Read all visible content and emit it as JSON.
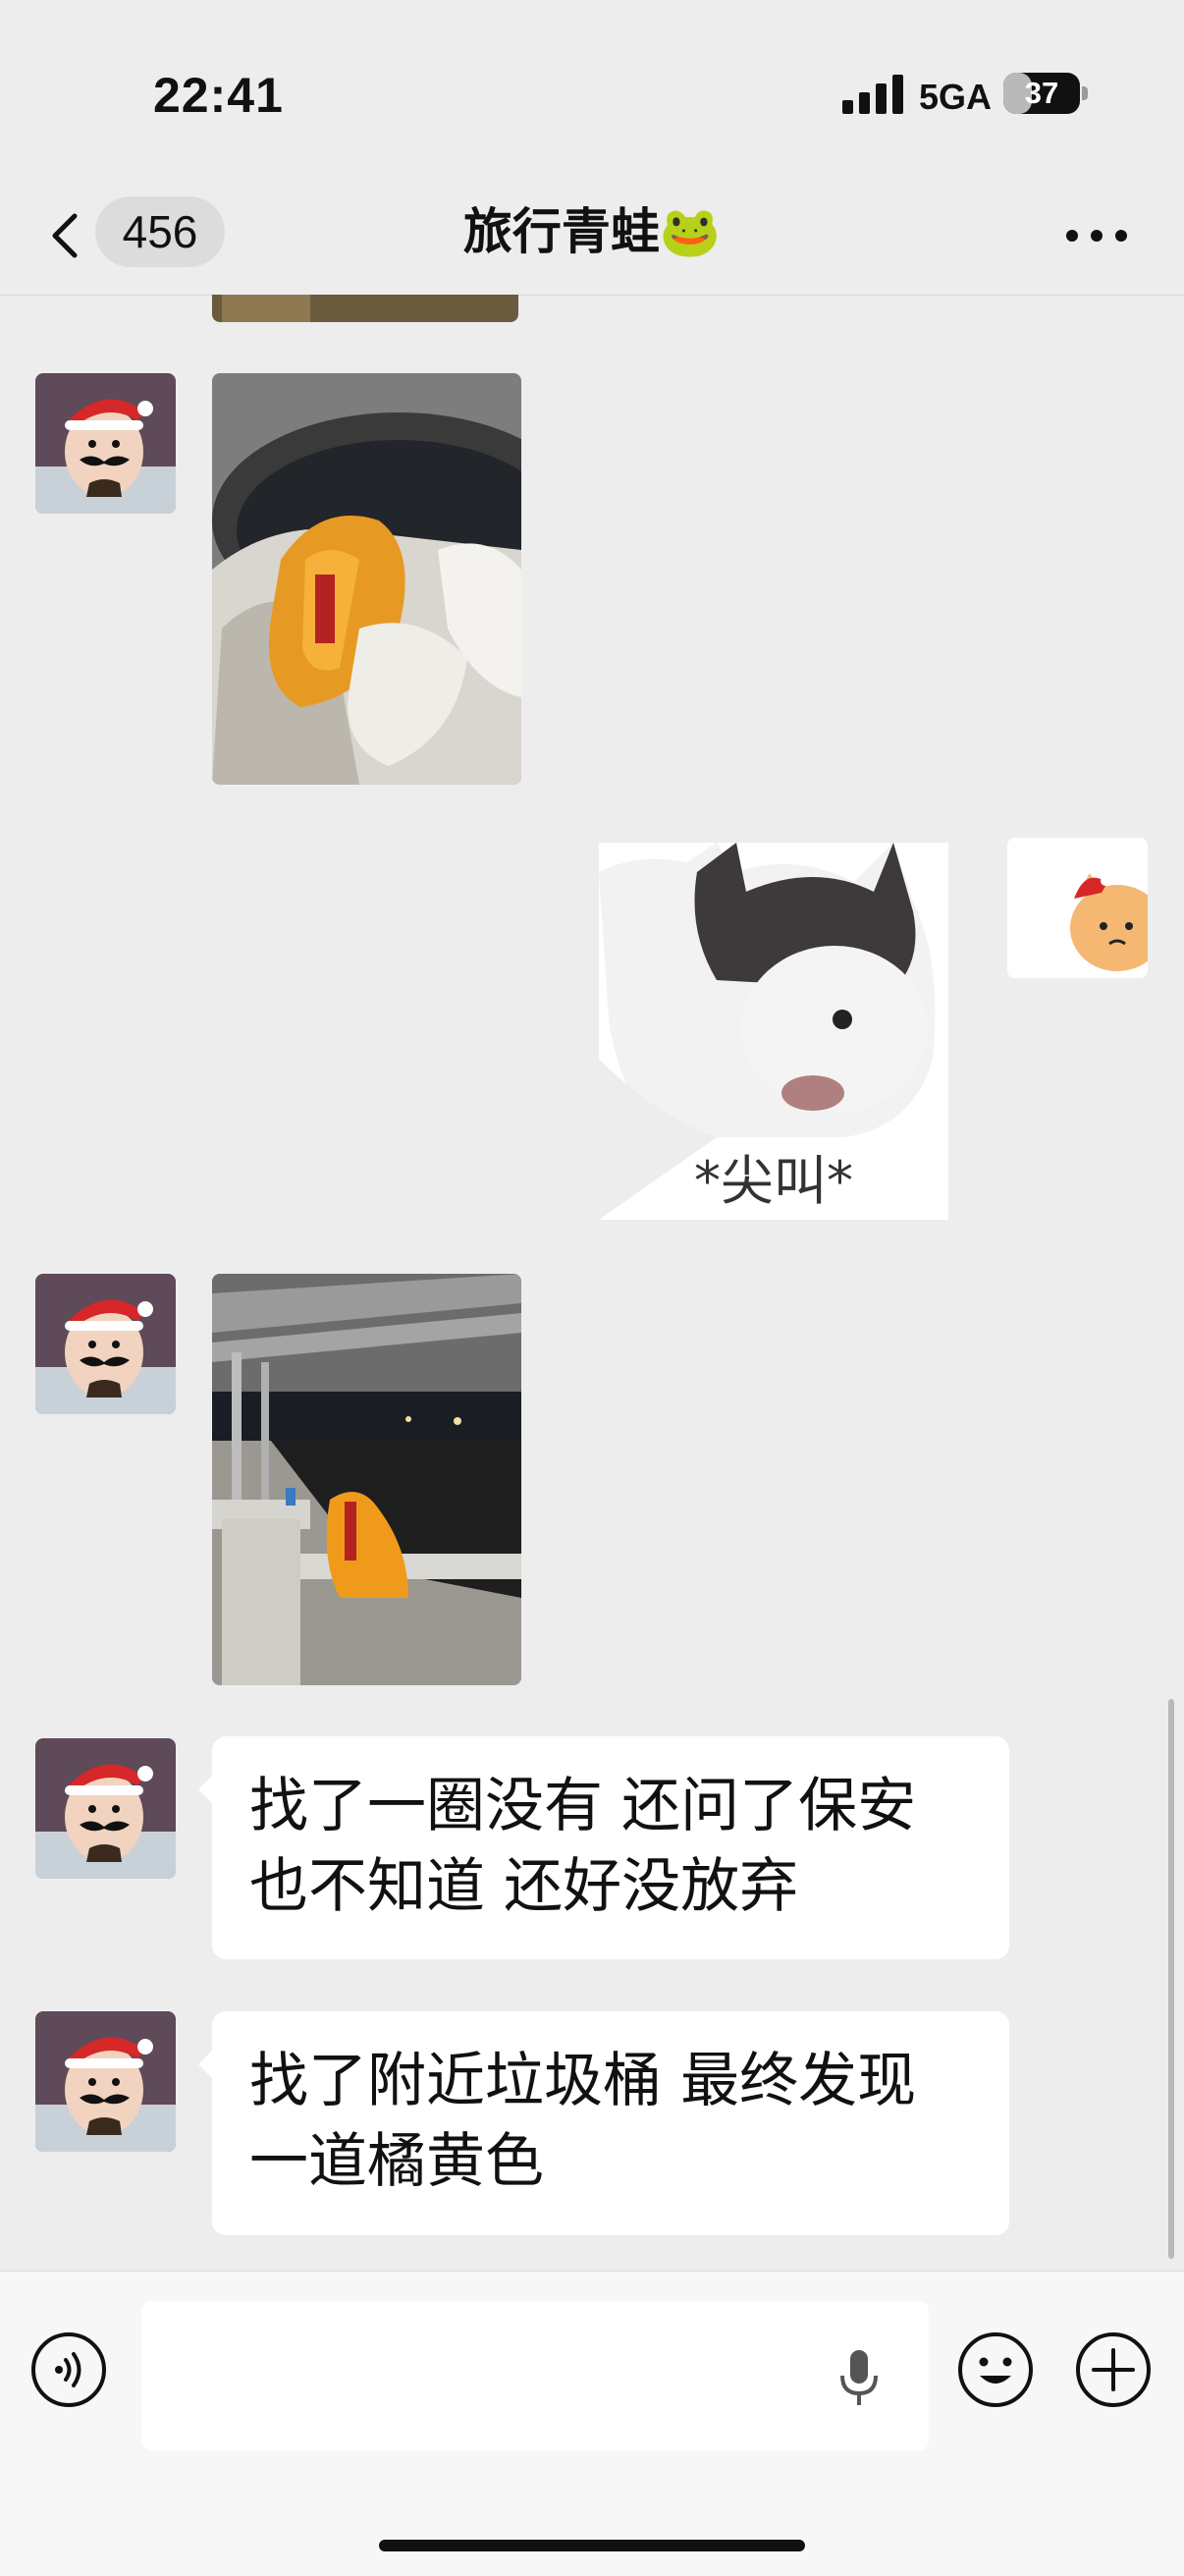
{
  "status_bar": {
    "time": "22:41",
    "network": "5GA",
    "battery": "37",
    "battery_level": 0.37,
    "icons": [
      "cellular-signal-icon",
      "battery-icon"
    ]
  },
  "nav": {
    "unread_count": "456",
    "title": "旅行青蛙🐸",
    "icons": [
      "back-chevron-icon",
      "more-icon"
    ]
  },
  "messages": [
    {
      "sender": "other",
      "type": "image",
      "content": "shoe-in-trash-can-photo"
    },
    {
      "sender": "self",
      "type": "sticker",
      "caption": "*尖叫*"
    },
    {
      "sender": "other",
      "type": "image",
      "content": "shoe-on-railing-photo"
    },
    {
      "sender": "other",
      "type": "text",
      "text": "找了一圈没有 还问了保安\n也不知道 还好没放弃"
    },
    {
      "sender": "other",
      "type": "text",
      "text": "找了附近垃圾桶 最终发现\n一道橘黄色"
    }
  ],
  "input_bar": {
    "placeholder": "",
    "icons": [
      "voice-icon",
      "microphone-icon",
      "emoji-icon",
      "plus-icon"
    ]
  },
  "colors": {
    "background": "#ededed",
    "bubble": "#ffffff",
    "input_bar": "#f7f7f7"
  }
}
